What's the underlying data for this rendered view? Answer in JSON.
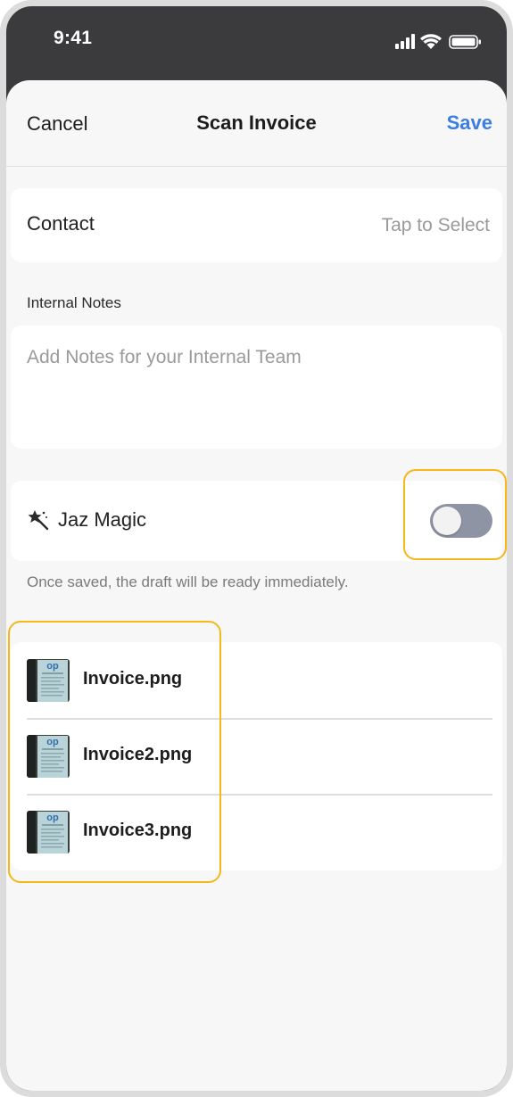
{
  "status_bar": {
    "time": "9:41",
    "icons": [
      "signal-icon",
      "wifi-icon",
      "battery-icon"
    ]
  },
  "nav": {
    "cancel_label": "Cancel",
    "title": "Scan Invoice",
    "save_label": "Save"
  },
  "contact": {
    "label": "Contact",
    "value_placeholder": "Tap to Select"
  },
  "internal_notes": {
    "label": "Internal Notes",
    "placeholder": "Add Notes for your Internal Team"
  },
  "jaz_magic": {
    "icon": "magic-wand-icon",
    "label": "Jaz Magic",
    "enabled": false,
    "helper_text": "Once saved, the draft will be ready immediately."
  },
  "files": [
    {
      "name": "Invoice.png"
    },
    {
      "name": "Invoice2.png"
    },
    {
      "name": "Invoice3.png"
    }
  ],
  "colors": {
    "accent": "#3a7fe0",
    "highlight": "#f5b71a",
    "toggle_off": "#8e94a4",
    "background": "#f7f7f7"
  }
}
